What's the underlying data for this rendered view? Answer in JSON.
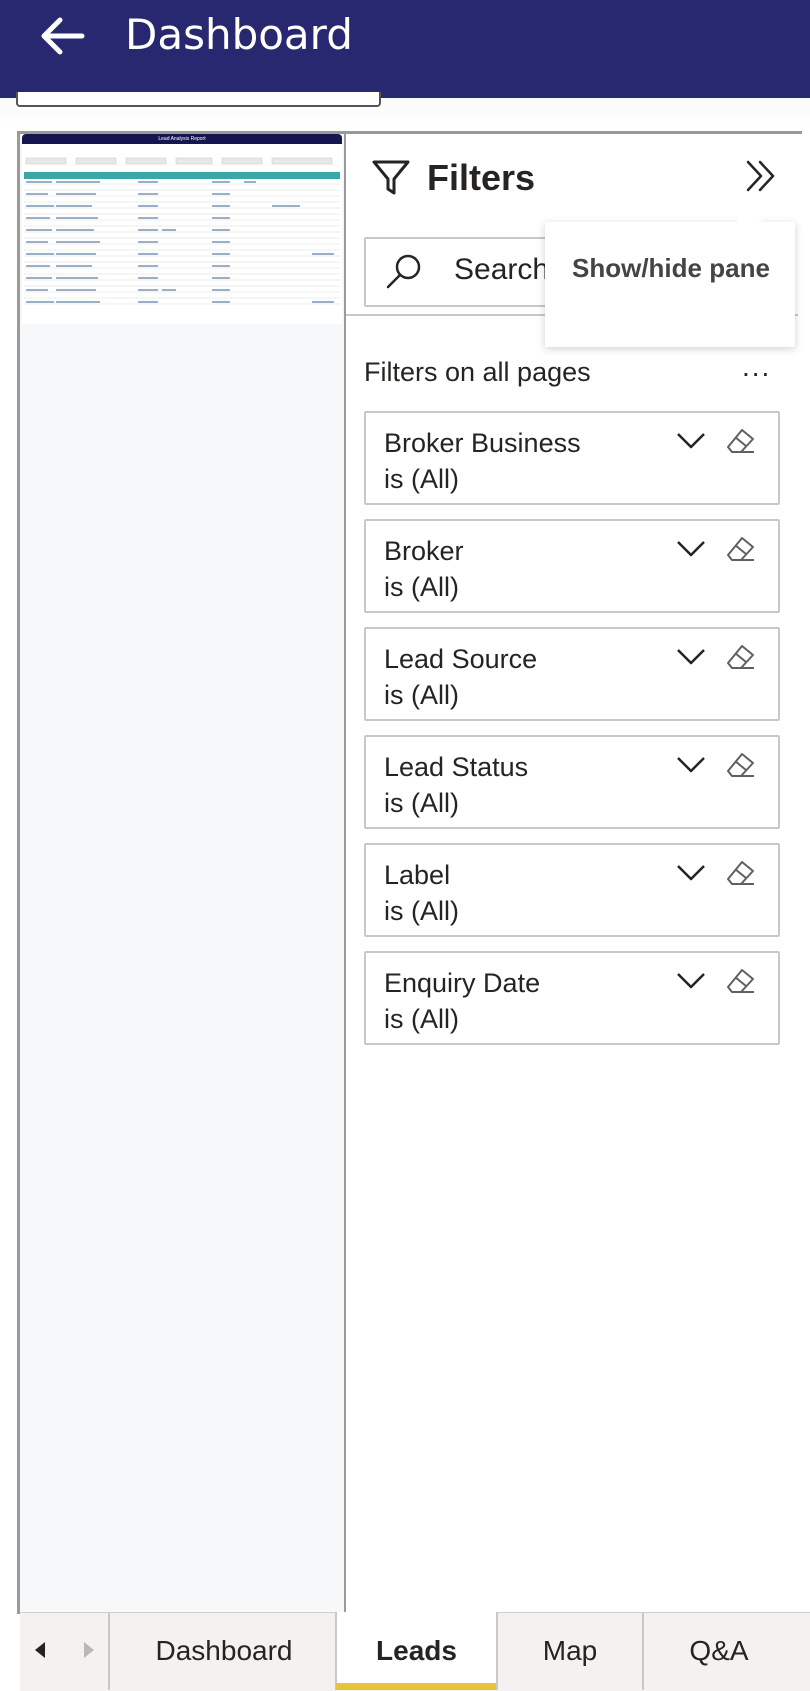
{
  "appbar": {
    "title": "Dashboard",
    "back_icon": "arrow-left-icon"
  },
  "report_preview": {
    "title": "Lead Analysis Report"
  },
  "filters_pane": {
    "title": "Filters",
    "search_placeholder": "Search",
    "tooltip": "Show/hide pane",
    "section_title": "Filters on all pages",
    "section_more": "...",
    "filters": [
      {
        "name": "Broker Business",
        "condition": "is (All)"
      },
      {
        "name": "Broker",
        "condition": "is (All)"
      },
      {
        "name": "Lead Source",
        "condition": "is (All)"
      },
      {
        "name": "Lead Status",
        "condition": "is (All)"
      },
      {
        "name": "Label",
        "condition": "is (All)"
      },
      {
        "name": "Enquiry Date",
        "condition": "is (All)"
      }
    ]
  },
  "tabs": [
    {
      "label": "Dashboard",
      "active": false
    },
    {
      "label": "Leads",
      "active": true
    },
    {
      "label": "Map",
      "active": false
    },
    {
      "label": "Q&A",
      "active": false
    }
  ],
  "colors": {
    "appbar": "#272870",
    "active_tab_indicator": "#e8c33a"
  }
}
